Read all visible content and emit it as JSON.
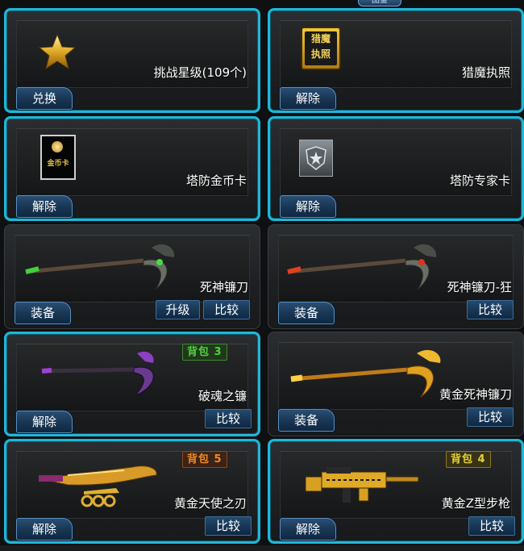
{
  "top_tab": "图鉴",
  "cards": [
    {
      "name": "挑战星级(109个)",
      "button": "兑换",
      "icon": "gold-star-icon"
    },
    {
      "name": "猎魔执照",
      "button": "解除",
      "icon": "hunter-license-icon",
      "icon_text": "猎魔\n执照"
    },
    {
      "name": "塔防金币卡",
      "button": "解除",
      "icon": "gold-coin-card-icon",
      "icon_text": "金币卡"
    },
    {
      "name": "塔防专家卡",
      "button": "解除",
      "icon": "expert-card-icon"
    },
    {
      "name": "死神镰刀",
      "button": "装备",
      "upgrade": "升级",
      "compare": "比较",
      "icon": "scythe-green-icon"
    },
    {
      "name": "死神镰刀-狂",
      "button": "装备",
      "compare": "比较",
      "icon": "scythe-red-icon"
    },
    {
      "name": "破魂之镰",
      "button": "解除",
      "compare": "比较",
      "tag": "背包 3",
      "icon": "scythe-purple-icon"
    },
    {
      "name": "黄金死神镰刀",
      "button": "装备",
      "compare": "比较",
      "icon": "scythe-gold-icon"
    },
    {
      "name": "黄金天使之刃",
      "button": "解除",
      "compare": "比较",
      "tag": "背包 5",
      "icon": "golden-blade-icon"
    },
    {
      "name": "黄金Z型步枪",
      "button": "解除",
      "compare": "比较",
      "tag": "背包 4",
      "icon": "golden-rifle-icon"
    }
  ],
  "colors": {
    "selected_border": "#21b7d8",
    "button_blue": "#183552",
    "tag_green": "#55d040",
    "tag_orange": "#f08a2a",
    "tag_yellow": "#e6d03a"
  }
}
